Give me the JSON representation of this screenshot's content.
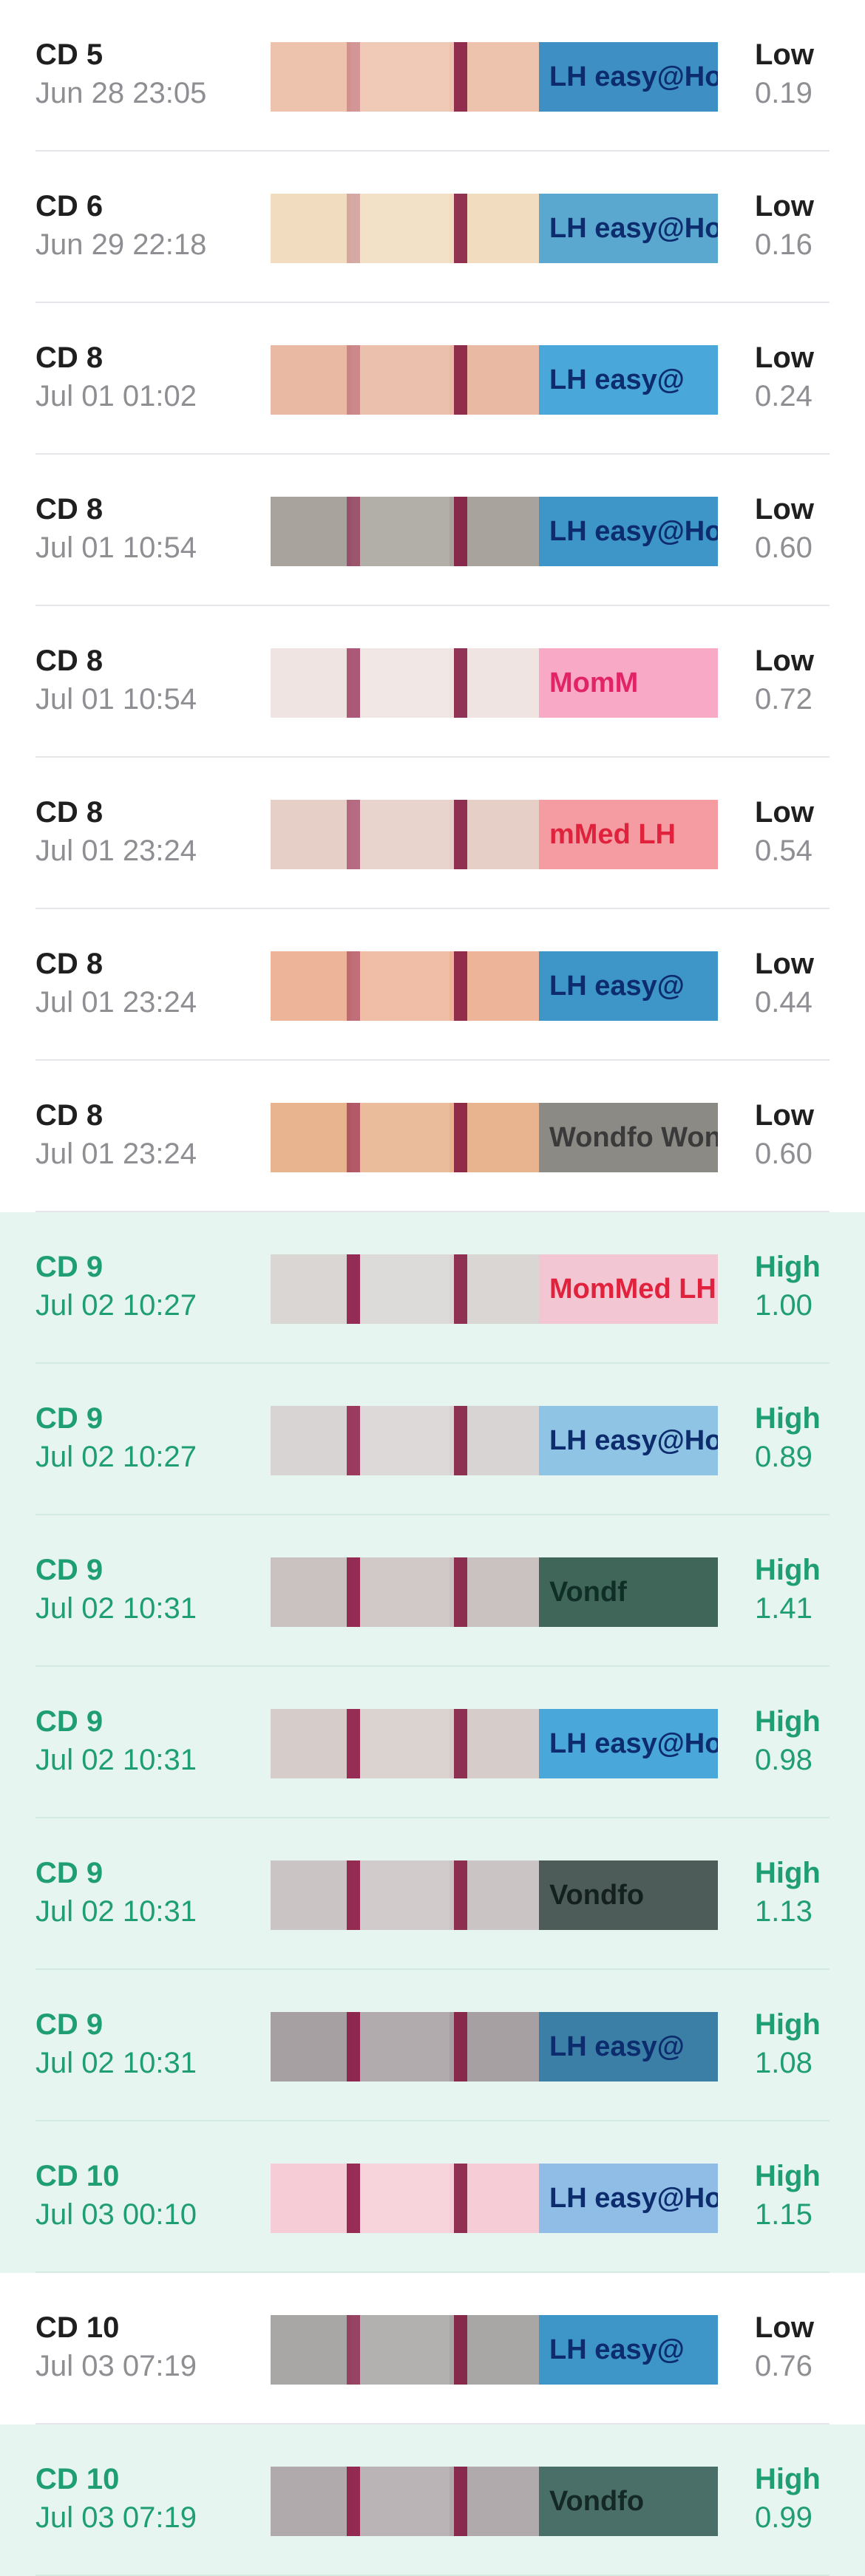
{
  "colors": {
    "high_accent": "#1f9e74",
    "high_background": "#e6f5ef",
    "low_text": "#1f1f1f",
    "muted_text": "#8e8e93"
  },
  "tests": [
    {
      "cycle_day": "CD 5",
      "datetime": "Jun 28 23:05",
      "level": "Low",
      "ratio": "0.19",
      "is_high": false,
      "brand_text": "LH  easy@Home",
      "strip_color": "#eec3ad",
      "handle_color": "#3e8fc4",
      "handle_text_color": "#0d2c6d"
    },
    {
      "cycle_day": "CD 6",
      "datetime": "Jun 29 22:18",
      "level": "Low",
      "ratio": "0.16",
      "is_high": false,
      "brand_text": "LH easy@Home LH",
      "strip_color": "#f1dcc0",
      "handle_color": "#5aa7cf",
      "handle_text_color": "#0d2c6d"
    },
    {
      "cycle_day": "CD 8",
      "datetime": "Jul 01 01:02",
      "level": "Low",
      "ratio": "0.24",
      "is_high": false,
      "brand_text": "LH  easy@",
      "strip_color": "#e9b9a3",
      "handle_color": "#4aa7d9",
      "handle_text_color": "#0d2c6d"
    },
    {
      "cycle_day": "CD 8",
      "datetime": "Jul 01 10:54",
      "level": "Low",
      "ratio": "0.60",
      "is_high": false,
      "brand_text": "LH  easy@Home",
      "strip_color": "#a8a39d",
      "handle_color": "#3e95c8",
      "handle_text_color": "#0d2c6d"
    },
    {
      "cycle_day": "CD 8",
      "datetime": "Jul 01 10:54",
      "level": "Low",
      "ratio": "0.72",
      "is_high": false,
      "brand_text": "MomM",
      "strip_color": "#efe4e2",
      "handle_color": "#f7a9c6",
      "handle_text_color": "#e22466"
    },
    {
      "cycle_day": "CD 8",
      "datetime": "Jul 01 23:24",
      "level": "Low",
      "ratio": "0.54",
      "is_high": false,
      "brand_text": "mMed LH",
      "strip_color": "#e5cfc6",
      "handle_color": "#f49ca1",
      "handle_text_color": "#e0223d"
    },
    {
      "cycle_day": "CD 8",
      "datetime": "Jul 01 23:24",
      "level": "Low",
      "ratio": "0.44",
      "is_high": false,
      "brand_text": "LH  easy@",
      "strip_color": "#eeb49a",
      "handle_color": "#3e95c8",
      "handle_text_color": "#0d2c6d"
    },
    {
      "cycle_day": "CD 8",
      "datetime": "Jul 01 23:24",
      "level": "Low",
      "ratio": "0.60",
      "is_high": false,
      "brand_text": "Wondfo  Wondfo",
      "strip_color": "#e8b38f",
      "handle_color": "#8c8a84",
      "handle_text_color": "#3a3a3a"
    },
    {
      "cycle_day": "CD 9",
      "datetime": "Jul 02 10:27",
      "level": "High",
      "ratio": "1.00",
      "is_high": true,
      "brand_text": "MomMed LH",
      "strip_color": "#d9d6d4",
      "handle_color": "#f3c6d3",
      "handle_text_color": "#e0223d"
    },
    {
      "cycle_day": "CD 9",
      "datetime": "Jul 02 10:27",
      "level": "High",
      "ratio": "0.89",
      "is_high": true,
      "brand_text": "LH easy@Home LH",
      "strip_color": "#d8d4d3",
      "handle_color": "#8fc4e4",
      "handle_text_color": "#0d2c6d"
    },
    {
      "cycle_day": "CD 9",
      "datetime": "Jul 02 10:31",
      "level": "High",
      "ratio": "1.41",
      "is_high": true,
      "brand_text": "Vondf",
      "strip_color": "#cac2c0",
      "handle_color": "#3f6659",
      "handle_text_color": "#0f2e26"
    },
    {
      "cycle_day": "CD 9",
      "datetime": "Jul 02 10:31",
      "level": "High",
      "ratio": "0.98",
      "is_high": true,
      "brand_text": "LH  easy@Home",
      "strip_color": "#d6cdca",
      "handle_color": "#4aa7d9",
      "handle_text_color": "#0d2c6d"
    },
    {
      "cycle_day": "CD 9",
      "datetime": "Jul 02 10:31",
      "level": "High",
      "ratio": "1.13",
      "is_high": true,
      "brand_text": "Vondfo",
      "strip_color": "#cbc4c4",
      "handle_color": "#4d5c59",
      "handle_text_color": "#14201d"
    },
    {
      "cycle_day": "CD 9",
      "datetime": "Jul 02 10:31",
      "level": "High",
      "ratio": "1.08",
      "is_high": true,
      "brand_text": "LH  easy@",
      "strip_color": "#a7a0a2",
      "handle_color": "#3b7fa6",
      "handle_text_color": "#0d2c6d"
    },
    {
      "cycle_day": "CD 10",
      "datetime": "Jul 03 00:10",
      "level": "High",
      "ratio": "1.15",
      "is_high": true,
      "brand_text": "LH easy@Home",
      "strip_color": "#f6cdd6",
      "handle_color": "#8fbde6",
      "handle_text_color": "#0d2c6d"
    },
    {
      "cycle_day": "CD 10",
      "datetime": "Jul 03 07:19",
      "level": "Low",
      "ratio": "0.76",
      "is_high": false,
      "brand_text": "LH  easy@",
      "strip_color": "#a9a6a6",
      "handle_color": "#3e95c8",
      "handle_text_color": "#0d2c6d"
    },
    {
      "cycle_day": "CD 10",
      "datetime": "Jul 03 07:19",
      "level": "High",
      "ratio": "0.99",
      "is_high": true,
      "brand_text": "Vondfo",
      "strip_color": "#b1aaac",
      "handle_color": "#4a6f68",
      "handle_text_color": "#142825"
    }
  ]
}
